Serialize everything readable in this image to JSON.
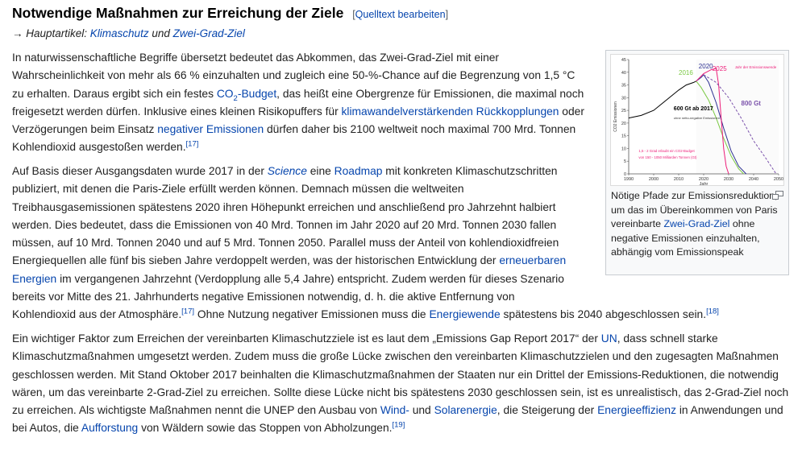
{
  "heading": {
    "title": "Notwendige Maßnahmen zur Erreichung der Ziele",
    "edit_open": "[",
    "edit_label": "Quelltext bearbeiten",
    "edit_close": "]"
  },
  "hatnote": {
    "prefix": "→ Hauptartikel: ",
    "link1": "Klimaschutz",
    "and": " und ",
    "link2": "Zwei-Grad-Ziel"
  },
  "p1": {
    "t1": "In naturwissenschaftliche Begriffe übersetzt bedeutet das Abkommen, das Zwei-Grad-Ziel mit einer Wahrscheinlichkeit von mehr als 66 % einzuhalten und zugleich eine 50-%-Chance auf die Begrenzung von 1,5 °C zu erhalten. Daraus ergibt sich ein festes ",
    "co2_a": "CO",
    "co2_sub": "2",
    "co2_b": "-Budget",
    "t2": ", das heißt eine Obergrenze für Emissionen, die maximal noch freigesetzt werden dürfen. Inklusive eines kleinen Risikopuffers für ",
    "l1": "klimawandelverstärkenden Rückkopplungen",
    "t3": " oder Verzögerungen beim Einsatz ",
    "l2": "negativer Emissionen",
    "t4": " dürfen daher bis 2100 weltweit noch maximal 700 Mrd. Tonnen Kohlendioxid ausgestoßen werden.",
    "ref": "[17]"
  },
  "p2": {
    "t1": "Auf Basis dieser Ausgangsdaten wurde 2017 in der ",
    "l1": "Science",
    "t2": " eine ",
    "l2": "Roadmap",
    "t3": " mit konkreten Klimaschutzschritten publiziert, mit denen die Paris-Ziele erfüllt werden können. Demnach müssen die weltweiten Treibhausgasemissionen spätestens 2020 ihren Höhepunkt erreichen und anschließend pro Jahrzehnt halbiert werden. Dies bedeutet, dass die Emissionen von 40 Mrd. Tonnen im Jahr 2020 auf 20 Mrd. Tonnen 2030 fallen müssen, auf 10 Mrd. Tonnen 2040 und auf 5 Mrd. Tonnen 2050. Parallel muss der Anteil von kohlendioxidfreien Energiequellen alle fünf bis sieben Jahre verdoppelt werden, was der historischen Entwicklung der ",
    "l3": "erneuerbaren Energien",
    "t4": " im vergangenen Jahrzehnt (Verdopplung alle 5,4 Jahre) entspricht. Zudem werden für dieses Szenario bereits vor Mitte des 21. Jahrhunderts negative Emissionen notwendig, d. h. die aktive Entfernung von",
    "t5": "Kohlendioxid aus der Atmosphäre.",
    "ref1": "[17]",
    "t6": " Ohne Nutzung negativer Emissionen muss die ",
    "l4": "Energiewende",
    "t7": " spätestens bis 2040 abgeschlossen sein.",
    "ref2": "[18]"
  },
  "p3": {
    "t1": "Ein wichtiger Faktor zum Erreichen der vereinbarten Klimaschutzziele ist es laut dem „Emissions Gap Report 2017“ der ",
    "l1": "UN",
    "t2": ", dass schnell starke Klimaschutzmaßnahmen umgesetzt werden. Zudem muss die große Lücke zwischen den vereinbarten Klimaschutzzielen und den zugesagten Maßnahmen geschlossen werden. Mit Stand Oktober 2017 beinhalten die Klimaschutzmaßnahmen der Staaten nur ein Drittel der Emissions-Reduktionen, die notwendig wären, um das vereinbarte 2-Grad-Ziel zu erreichen. Sollte diese Lücke nicht bis spätestens 2030 geschlossen sein, ist es unrealistisch, das 2-Grad-Ziel noch zu erreichen. Als wichtigste Maßnahmen nennt die UNEP den Ausbau von ",
    "l2": "Wind-",
    "t3": " und ",
    "l3": "Solarenergie",
    "t4": ", die Steigerung der ",
    "l4": "Energieeffizienz",
    "t5": " in Anwendungen und bei Autos, die ",
    "l5": "Aufforstung",
    "t6": " von Wäldern sowie das Stoppen von Abholzungen.",
    "ref": "[19]"
  },
  "figure": {
    "caption_t1": "Nötige Pfade zur Emissionsreduktion, um das im Übereinkommen von Paris vereinbarte ",
    "caption_link": "Zwei-Grad-Ziel",
    "caption_t2": " ohne negative Emissionen einzuhalten, abhängig vom Emissionspeak",
    "enlarge_icon": "enlarge-icon"
  },
  "chart_data": {
    "type": "line",
    "title": "",
    "xlabel": "Jahr",
    "ylabel": "CO2 Emissionen",
    "xlim": [
      1990,
      2050
    ],
    "ylim": [
      0,
      45
    ],
    "x_ticks": [
      1990,
      2000,
      2010,
      2020,
      2030,
      2040,
      2050
    ],
    "y_ticks": [
      0,
      5,
      10,
      15,
      20,
      25,
      30,
      35,
      40,
      45
    ],
    "grid": false,
    "history": {
      "color": "#000000",
      "points": [
        [
          1990,
          22
        ],
        [
          1995,
          23
        ],
        [
          2000,
          25
        ],
        [
          2005,
          29
        ],
        [
          2010,
          33
        ],
        [
          2013,
          35
        ],
        [
          2016,
          36
        ],
        [
          2017,
          36.5
        ]
      ]
    },
    "series": [
      {
        "name": "2016",
        "color": "#7ac943",
        "points": [
          [
            2017,
            36.5
          ],
          [
            2019,
            34
          ],
          [
            2022,
            29
          ],
          [
            2025,
            22
          ],
          [
            2028,
            14
          ],
          [
            2031,
            7
          ],
          [
            2034,
            2
          ],
          [
            2036,
            0
          ]
        ]
      },
      {
        "name": "2020",
        "color": "#2e3192",
        "points": [
          [
            2017,
            36.5
          ],
          [
            2019,
            38
          ],
          [
            2020,
            39
          ],
          [
            2022,
            36
          ],
          [
            2025,
            28
          ],
          [
            2028,
            18
          ],
          [
            2031,
            9
          ],
          [
            2034,
            3
          ],
          [
            2037,
            0
          ]
        ]
      },
      {
        "name": "2025",
        "color": "#ed1e79",
        "points": [
          [
            2017,
            36.5
          ],
          [
            2020,
            39.5
          ],
          [
            2023,
            41
          ],
          [
            2025,
            41.5
          ],
          [
            2026,
            35
          ],
          [
            2027,
            22
          ],
          [
            2028,
            10
          ],
          [
            2029,
            3
          ],
          [
            2030,
            0
          ]
        ]
      },
      {
        "name": "800 Gt",
        "color": "#7b52ab",
        "dashed": true,
        "points": [
          [
            2020,
            39
          ],
          [
            2025,
            36
          ],
          [
            2030,
            30
          ],
          [
            2035,
            22
          ],
          [
            2040,
            13
          ],
          [
            2045,
            6
          ],
          [
            2049,
            0
          ]
        ]
      }
    ],
    "annotations": {
      "label_2016": "2016",
      "label_2020": "2020",
      "label_2025": "2025",
      "peak_note": "Jahr der Emissionswende",
      "budget_600": "600 Gt ab 2017",
      "budget_600_sub": "ohne netto-negative Emissionen",
      "budget_800": "800 Gt",
      "range_note_1": "1,5 - 2 Grad erlaubt ein CO2-Budget",
      "range_note_2": "von 150 - 1050 Milliarden Tonnen (Gt)"
    }
  }
}
